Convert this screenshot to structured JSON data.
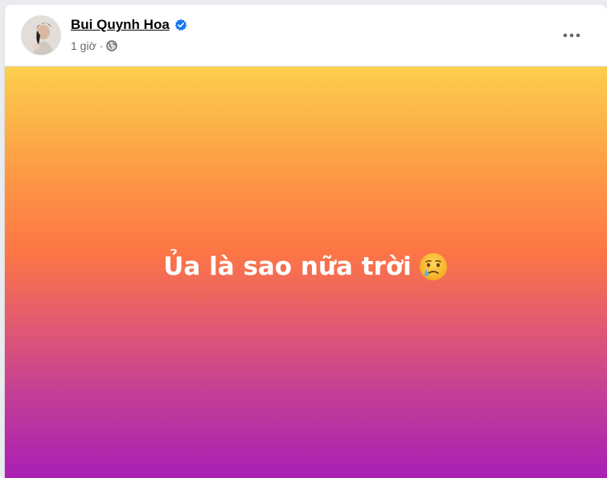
{
  "post": {
    "author": "Bui Quynh Hoa",
    "time": "1 giờ",
    "separator": "·",
    "text": "Ủa là sao nữa trời",
    "emoji": "crying-face-icon",
    "verified_icon": "verified-badge-icon",
    "privacy_icon": "globe-icon",
    "more_icon": "more-options-icon",
    "colors": {
      "gradient_top": "#fccf4c",
      "gradient_middle": "#fd7645",
      "gradient_bottom": "#a91fb5",
      "verified": "#1877f2"
    }
  }
}
